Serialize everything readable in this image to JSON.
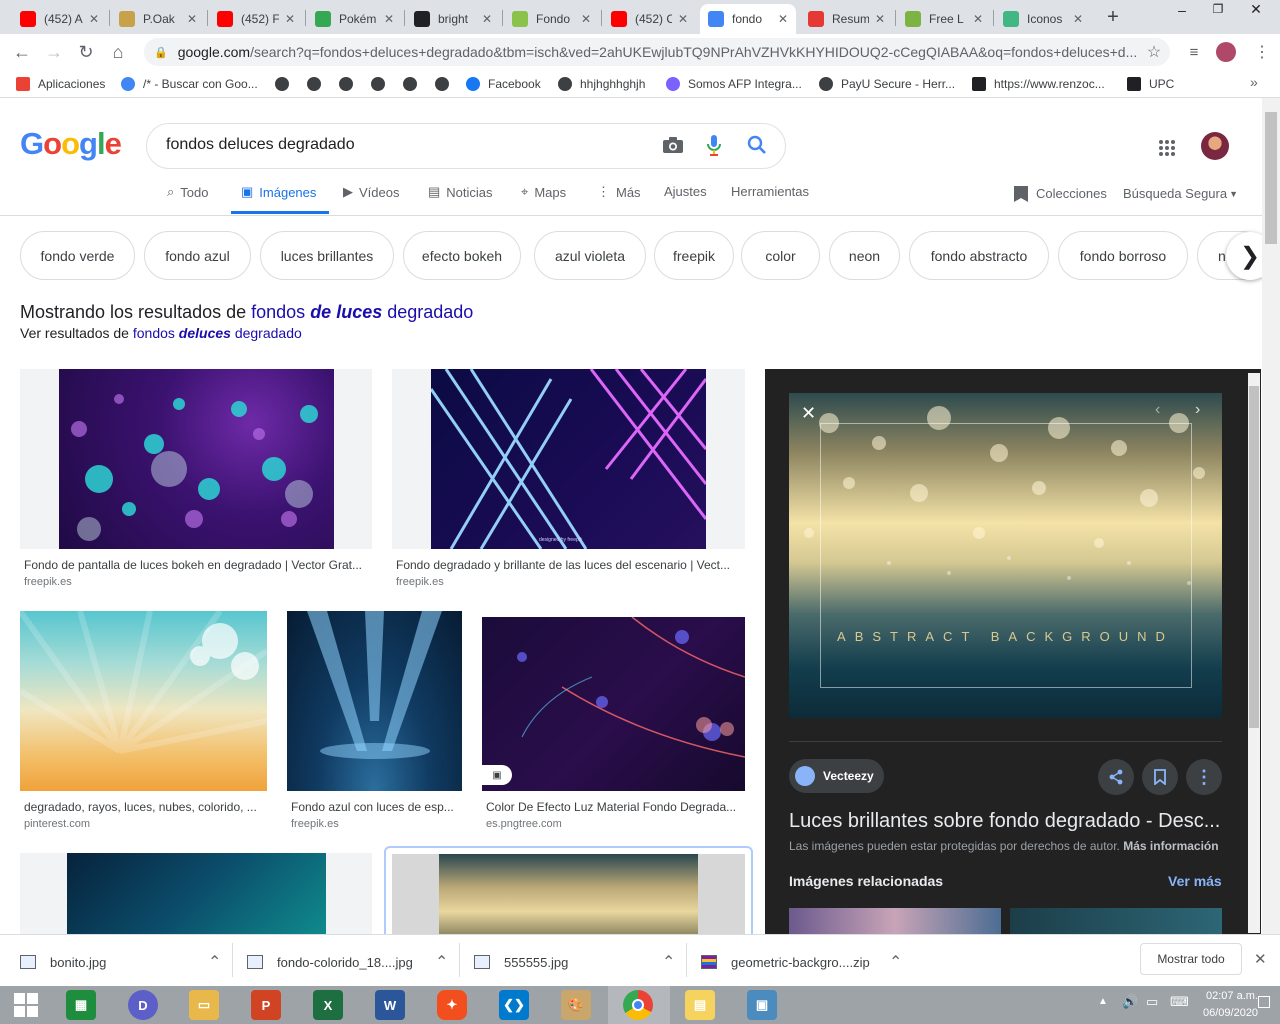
{
  "browser": {
    "tabs": [
      {
        "title": "(452) A",
        "favicon": "youtube-icon",
        "color": "#ff0000"
      },
      {
        "title": "P.Oak",
        "favicon": "moustache-icon",
        "color": "#c8a24a"
      },
      {
        "title": "(452) F",
        "favicon": "youtube-icon",
        "color": "#ff0000"
      },
      {
        "title": "Pokém",
        "favicon": "play-store-icon",
        "color": "#34a853"
      },
      {
        "title": "bright",
        "favicon": "shutterstock-icon",
        "color": "#202124"
      },
      {
        "title": "Fondo",
        "favicon": "wh-icon",
        "color": "#8bc34a"
      },
      {
        "title": "(452) C",
        "favicon": "youtube-icon",
        "color": "#ff0000"
      },
      {
        "title": "fondo",
        "favicon": "google-icon",
        "color": "#4285f4"
      },
      {
        "title": "Resum",
        "favicon": "v-icon",
        "color": "#e53935"
      },
      {
        "title": "Free L",
        "favicon": "leaf-icon",
        "color": "#7cb342"
      },
      {
        "title": "Iconos",
        "favicon": "vuejs-icon",
        "color": "#41b883"
      }
    ],
    "close_glyph": "✕",
    "new_tab_glyph": "+",
    "url_host": "google.com",
    "url_rest": "/search?q=fondos+deluces+degradado&tbm=isch&ved=2ahUKEwjlubTQ9NPrAhVZHVkKHYHIDOUQ2-cCegQIABAA&oq=fondos+deluces+d...",
    "bookmarks": [
      {
        "label": "Aplicaciones",
        "icon": "apps-grid-icon"
      },
      {
        "label": "/* - Buscar con Goo...",
        "icon": "google-icon"
      },
      {
        "label": "",
        "icon": "globe-icon"
      },
      {
        "label": "",
        "icon": "globe-icon"
      },
      {
        "label": "",
        "icon": "globe-icon"
      },
      {
        "label": "",
        "icon": "globe-icon"
      },
      {
        "label": "",
        "icon": "globe-icon"
      },
      {
        "label": "",
        "icon": "globe-icon"
      },
      {
        "label": "Facebook",
        "icon": "facebook-icon"
      },
      {
        "label": "hhjhghhghjh",
        "icon": "globe-icon"
      },
      {
        "label": "Somos AFP Integra...",
        "icon": "afp-icon"
      },
      {
        "label": "PayU Secure - Herr...",
        "icon": "globe-icon"
      },
      {
        "label": "https://www.renzoc...",
        "icon": "rc-icon"
      },
      {
        "label": "UPC",
        "icon": "upc-icon"
      }
    ],
    "bookmarks_more": "»"
  },
  "google": {
    "logo": "Google",
    "query": "fondos deluces degradado",
    "nav": [
      {
        "label": "Todo",
        "icon": "search-icon"
      },
      {
        "label": "Imágenes",
        "icon": "image-icon"
      },
      {
        "label": "Vídeos",
        "icon": "video-icon"
      },
      {
        "label": "Noticias",
        "icon": "news-icon"
      },
      {
        "label": "Maps",
        "icon": "map-pin-icon"
      },
      {
        "label": "Más",
        "icon": "more-vert-icon"
      },
      {
        "label": "Ajustes",
        "icon": ""
      },
      {
        "label": "Herramientas",
        "icon": ""
      }
    ],
    "collections": "Colecciones",
    "safe_search": "Búsqueda Segura",
    "chips": [
      "fondo verde",
      "fondo azul",
      "luces brillantes",
      "efecto bokeh",
      "azul violeta",
      "freepik",
      "color",
      "neon",
      "fondo abstracto",
      "fondo borroso",
      "na"
    ],
    "correction": {
      "prefix": "Mostrando los resultados de ",
      "w1": "fondos ",
      "w2": "de luces",
      "w3": " degradado",
      "alt_prefix": "Ver resultados de ",
      "alt1": "fondos ",
      "alt2": "deluces",
      "alt3": " degradado"
    },
    "results": [
      {
        "caption": "Fondo de pantalla de luces bokeh en degradado | Vector Grat...",
        "source": "freepik.es"
      },
      {
        "caption": "Fondo degradado y brillante de las luces del escenario | Vect...",
        "source": "freepik.es"
      },
      {
        "caption": "degradado, rayos, luces, nubes, colorido, ...",
        "source": "pinterest.com"
      },
      {
        "caption": "Fondo azul con luces de esp...",
        "source": "freepik.es"
      },
      {
        "caption": "Color De Efecto Luz Material Fondo Degrada...",
        "source": "es.pngtree.com"
      }
    ],
    "result_watermark": "designed by freepik"
  },
  "panel": {
    "image_text": "ABSTRACT BACKGROUND",
    "source": "Vecteezy",
    "title": "Luces brillantes sobre fondo degradado - Desc...",
    "copyright": "Las imágenes pueden estar protegidas por derechos de autor.",
    "more_info": "Más información",
    "related": "Imágenes relacionadas",
    "see_more": "Ver más"
  },
  "downloads": {
    "items": [
      "bonito.jpg",
      "fondo-colorido_18....jpg",
      "555555.jpg",
      "geometric-backgro....zip"
    ],
    "show_all": "Mostrar todo"
  },
  "taskbar": {
    "time": "02:07 a.m.",
    "date": "06/09/2020"
  }
}
